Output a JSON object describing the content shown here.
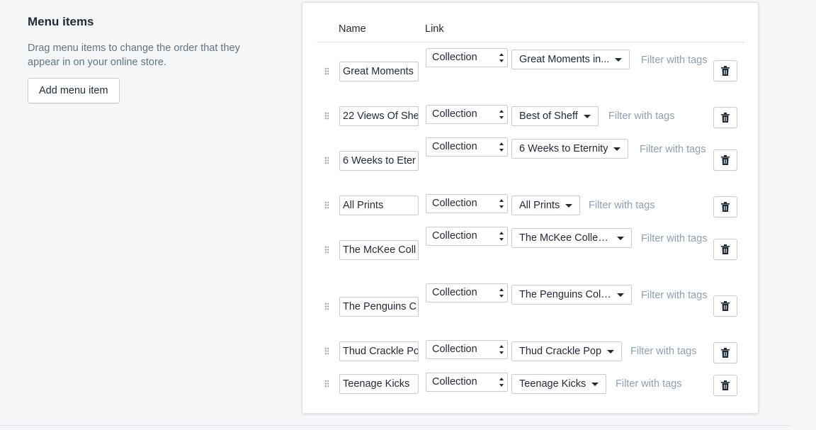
{
  "section": {
    "title": "Menu items",
    "description": "Drag menu items to change the order that they appear in on your online store.",
    "add_button": "Add menu item"
  },
  "table": {
    "col_name": "Name",
    "col_link": "Link"
  },
  "rows": [
    {
      "name": "Great Moments",
      "type": "Collection",
      "collection": "Great Moments in...",
      "filter": "Filter with tags"
    },
    {
      "name": "22 Views Of She",
      "type": "Collection",
      "collection": "Best of Sheff",
      "filter": "Filter with tags"
    },
    {
      "name": "6 Weeks to Eter",
      "type": "Collection",
      "collection": "6 Weeks to Eternity",
      "filter": "Filter with tags"
    },
    {
      "name": "All Prints",
      "type": "Collection",
      "collection": "All Prints",
      "filter": "Filter with tags"
    },
    {
      "name": "The McKee Coll",
      "type": "Collection",
      "collection": "The McKee Collec...",
      "filter": "Filter with tags"
    },
    {
      "name": "The Penguins C",
      "type": "Collection",
      "collection": "The Penguins Coll...",
      "filter": "Filter with tags"
    },
    {
      "name": "Thud Crackle Po",
      "type": "Collection",
      "collection": "Thud Crackle Pop",
      "filter": "Filter with tags"
    },
    {
      "name": "Teenage Kicks",
      "type": "Collection",
      "collection": "Teenage Kicks",
      "filter": "Filter with tags"
    }
  ],
  "icons": {
    "drag": "drag-handle-icon",
    "delete": "trash-icon",
    "select": "select-arrows-icon",
    "dropdown": "caret-down-icon"
  }
}
